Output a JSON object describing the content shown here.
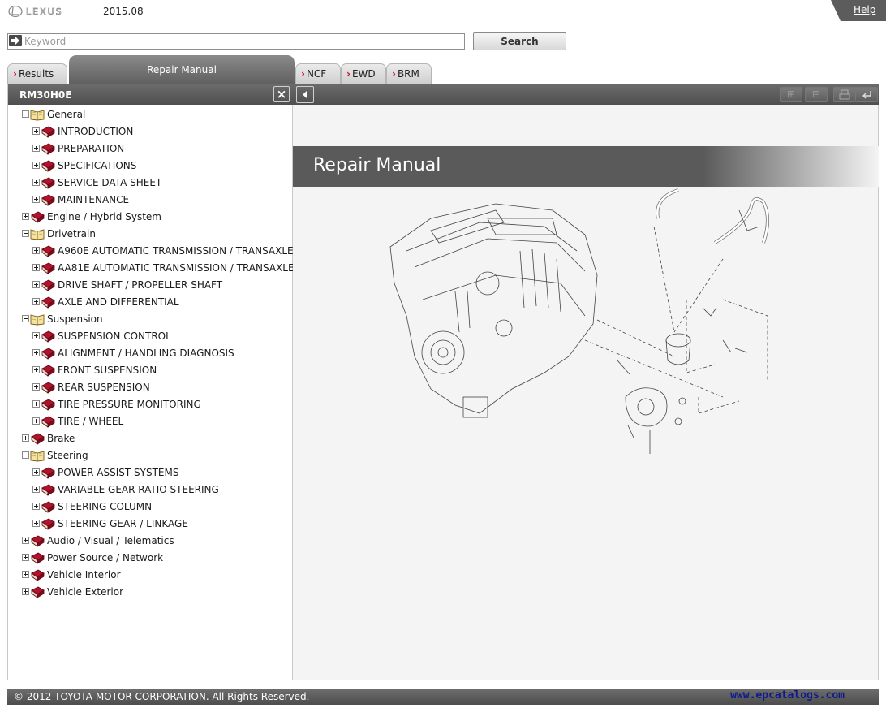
{
  "header": {
    "logo": "LEXUS",
    "release": "2015.08",
    "help_label": "Help"
  },
  "search": {
    "placeholder": "Keyword",
    "value": "",
    "button_label": "Search"
  },
  "tabs": {
    "results": "Results",
    "active": "Repair Manual",
    "ncf": "NCF",
    "ewd": "EWD",
    "brm": "BRM"
  },
  "left_panel": {
    "title": "RM30H0E",
    "close_symbol": "×"
  },
  "tree": [
    {
      "label": "General",
      "level": 0,
      "expanded": true
    },
    {
      "label": "INTRODUCTION",
      "level": 1,
      "expanded": false
    },
    {
      "label": "PREPARATION",
      "level": 1,
      "expanded": false
    },
    {
      "label": "SPECIFICATIONS",
      "level": 1,
      "expanded": false
    },
    {
      "label": "SERVICE DATA SHEET",
      "level": 1,
      "expanded": false
    },
    {
      "label": "MAINTENANCE",
      "level": 1,
      "expanded": false
    },
    {
      "label": "Engine / Hybrid System",
      "level": 0,
      "expanded": false
    },
    {
      "label": "Drivetrain",
      "level": 0,
      "expanded": true
    },
    {
      "label": "A960E AUTOMATIC TRANSMISSION / TRANSAXLE",
      "level": 1,
      "expanded": false
    },
    {
      "label": "AA81E AUTOMATIC TRANSMISSION / TRANSAXLE",
      "level": 1,
      "expanded": false
    },
    {
      "label": "DRIVE SHAFT / PROPELLER SHAFT",
      "level": 1,
      "expanded": false
    },
    {
      "label": "AXLE AND DIFFERENTIAL",
      "level": 1,
      "expanded": false
    },
    {
      "label": "Suspension",
      "level": 0,
      "expanded": true
    },
    {
      "label": "SUSPENSION CONTROL",
      "level": 1,
      "expanded": false
    },
    {
      "label": "ALIGNMENT / HANDLING DIAGNOSIS",
      "level": 1,
      "expanded": false
    },
    {
      "label": "FRONT SUSPENSION",
      "level": 1,
      "expanded": false
    },
    {
      "label": "REAR SUSPENSION",
      "level": 1,
      "expanded": false
    },
    {
      "label": "TIRE PRESSURE MONITORING",
      "level": 1,
      "expanded": false
    },
    {
      "label": "TIRE / WHEEL",
      "level": 1,
      "expanded": false
    },
    {
      "label": "Brake",
      "level": 0,
      "expanded": false
    },
    {
      "label": "Steering",
      "level": 0,
      "expanded": true
    },
    {
      "label": "POWER ASSIST SYSTEMS",
      "level": 1,
      "expanded": false
    },
    {
      "label": "VARIABLE GEAR RATIO STEERING",
      "level": 1,
      "expanded": false
    },
    {
      "label": "STEERING COLUMN",
      "level": 1,
      "expanded": false
    },
    {
      "label": "STEERING GEAR / LINKAGE",
      "level": 1,
      "expanded": false
    },
    {
      "label": "Audio / Visual / Telematics",
      "level": 0,
      "expanded": false
    },
    {
      "label": "Power Source / Network",
      "level": 0,
      "expanded": false
    },
    {
      "label": "Vehicle Interior",
      "level": 0,
      "expanded": false
    },
    {
      "label": "Vehicle Exterior",
      "level": 0,
      "expanded": false
    }
  ],
  "content": {
    "title": "Repair Manual"
  },
  "toolbar_icons": [
    "expand-icon",
    "collapse-icon",
    "print-icon",
    "back-icon"
  ],
  "footer": {
    "copyright": "© 2012 TOYOTA MOTOR CORPORATION. All Rights Reserved.",
    "watermark": "www.epcatalogs.com"
  },
  "colors": {
    "accent_red": "#c8102e",
    "bar_gray": "#5a5a5a",
    "watermark_blue": "#0b1a8c"
  }
}
